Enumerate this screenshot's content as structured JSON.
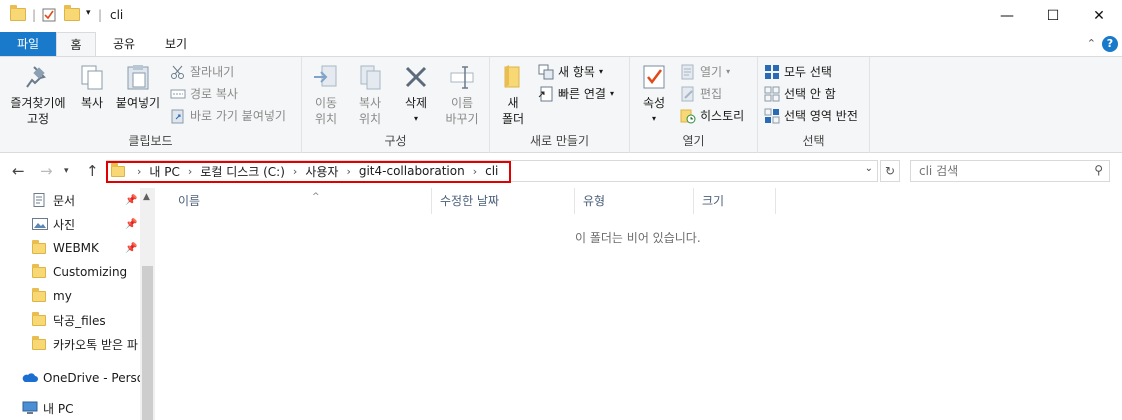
{
  "window": {
    "title": "cli",
    "controls": {
      "minimize": "—",
      "maximize": "☐",
      "close": "✕"
    }
  },
  "ribbon_tabs": [
    "파일",
    "홈",
    "공유",
    "보기"
  ],
  "ribbon": {
    "clipboard": {
      "label": "클립보드",
      "pin": "즐겨찾기에\n고정",
      "copy": "복사",
      "paste": "붙여넣기",
      "cut": "잘라내기",
      "copy_path": "경로 복사",
      "paste_shortcut": "바로 가기 붙여넣기"
    },
    "organize": {
      "label": "구성",
      "move_to": "이동\n위치",
      "copy_to": "복사\n위치",
      "delete": "삭제",
      "rename": "이름\n바꾸기"
    },
    "new": {
      "label": "새로 만들기",
      "new_folder": "새\n폴더",
      "new_item": "새 항목",
      "easy_access": "빠른 연결"
    },
    "open": {
      "label": "열기",
      "properties": "속성",
      "open": "열기",
      "edit": "편집",
      "history": "히스토리"
    },
    "select": {
      "label": "선택",
      "select_all": "모두 선택",
      "select_none": "선택 안 함",
      "invert": "선택 영역 반전"
    }
  },
  "address": {
    "breadcrumbs": [
      "내 PC",
      "로컬 디스크 (C:)",
      "사용자",
      "git4-collaboration",
      "cli"
    ],
    "search_placeholder": "cli 검색"
  },
  "nav_pane": {
    "items": [
      {
        "label": "문서",
        "pinned": true,
        "icon": "documents-icon"
      },
      {
        "label": "사진",
        "pinned": true,
        "icon": "pictures-icon"
      },
      {
        "label": "WEBMK",
        "pinned": true,
        "icon": "folder-icon"
      },
      {
        "label": "Customizing",
        "pinned": false,
        "icon": "folder-icon"
      },
      {
        "label": "my",
        "pinned": false,
        "icon": "folder-icon"
      },
      {
        "label": "닥공_files",
        "pinned": false,
        "icon": "folder-icon"
      },
      {
        "label": "카카오톡 받은 파",
        "pinned": false,
        "icon": "folder-icon"
      },
      {
        "label": "OneDrive - Person",
        "pinned": false,
        "icon": "onedrive-icon"
      },
      {
        "label": "내 PC",
        "pinned": false,
        "icon": "this-pc-icon"
      }
    ]
  },
  "columns": [
    "이름",
    "수정한 날짜",
    "유형",
    "크기"
  ],
  "empty_message": "이 폴더는 비어 있습니다.",
  "colors": {
    "file_tab": "#1979ca",
    "highlight": "#e00000",
    "folder": "#f8d775"
  }
}
